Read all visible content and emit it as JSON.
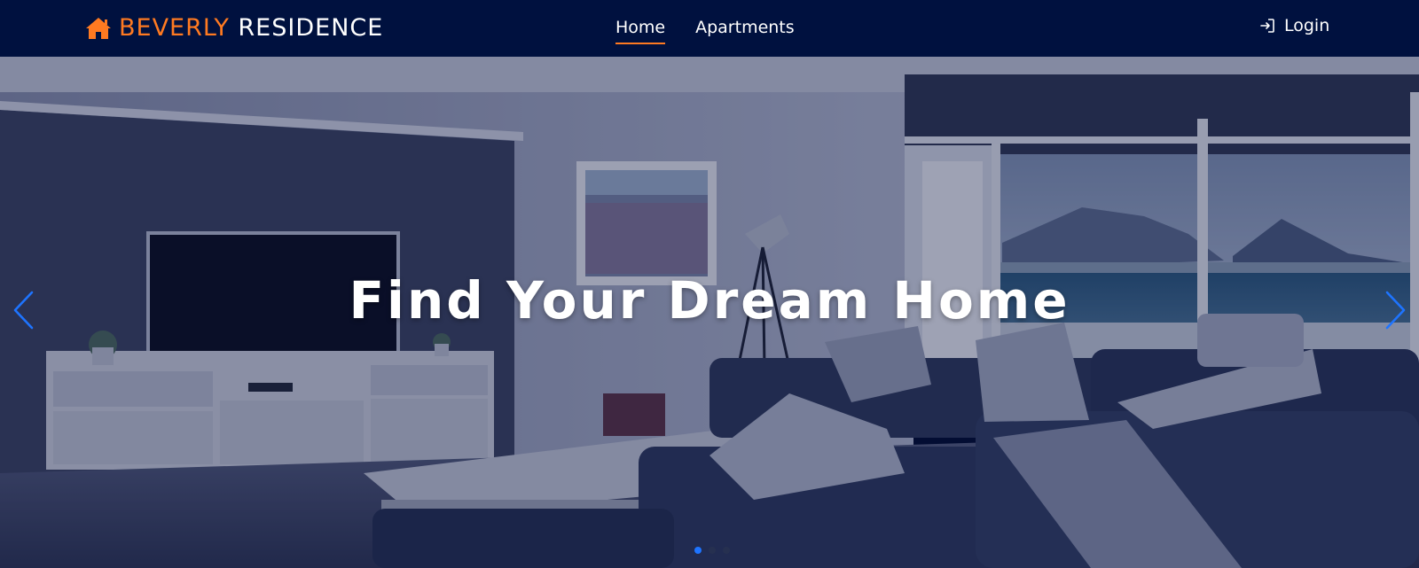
{
  "brand": {
    "accent_text": "BEVERLY",
    "main_text": "RESIDENCE",
    "icon": "home-icon"
  },
  "nav": {
    "items": [
      {
        "label": "Home",
        "active": true
      },
      {
        "label": "Apartments",
        "active": false
      }
    ]
  },
  "auth": {
    "login_label": "Login",
    "icon": "sign-in-icon"
  },
  "hero": {
    "title": "Find Your Dream Home",
    "prev_icon": "chevron-left-icon",
    "next_icon": "chevron-right-icon",
    "slide_count": 3,
    "active_slide": 1
  },
  "colors": {
    "navbar": "#00113f",
    "accent": "#ff7a21",
    "control_blue": "#1e74ff",
    "text": "#ffffff"
  }
}
